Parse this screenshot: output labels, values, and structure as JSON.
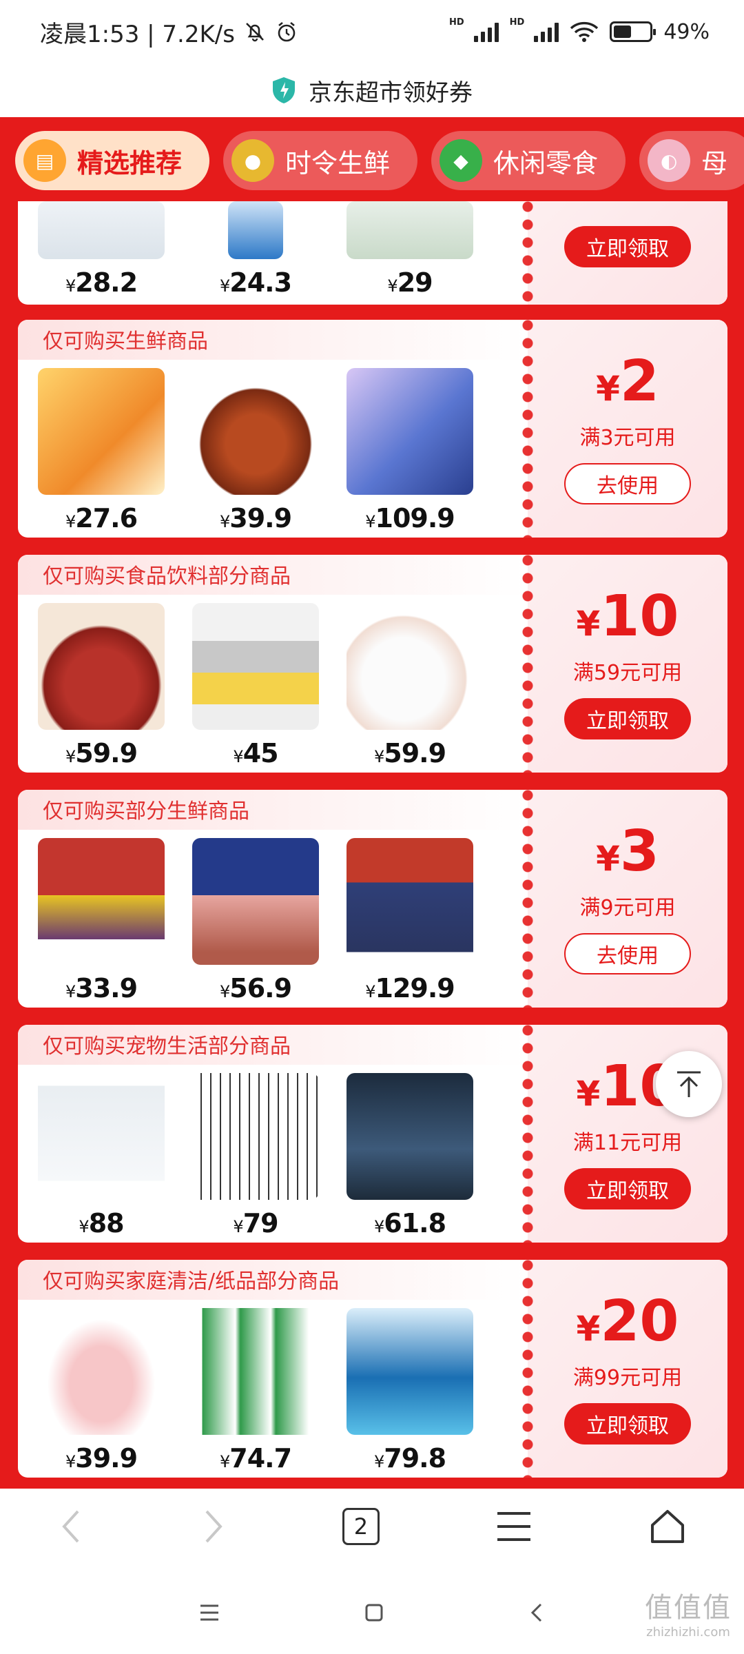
{
  "status_bar": {
    "time_net": "凌晨1:53 | 7.2K/s",
    "battery": "49%"
  },
  "title_bar": {
    "title": "京东超市领好券"
  },
  "tabs": [
    {
      "label": "精选推荐",
      "icon": "coupon-icon",
      "active": true
    },
    {
      "label": "时令生鲜",
      "icon": "durian-icon"
    },
    {
      "label": "休闲零食",
      "icon": "snack-icon"
    },
    {
      "label": "母",
      "icon": "bottle-icon"
    }
  ],
  "cards": [
    {
      "header": "",
      "products": [
        {
          "price": "28.2"
        },
        {
          "price": "24.3"
        },
        {
          "price": "29"
        }
      ],
      "amount": "",
      "condition": "",
      "button": "立即领取",
      "button_style": "filled"
    },
    {
      "header": "仅可购买生鲜商品",
      "products": [
        {
          "price": "27.6"
        },
        {
          "price": "39.9"
        },
        {
          "price": "109.9"
        }
      ],
      "amount": "2",
      "condition": "满3元可用",
      "button": "去使用",
      "button_style": "outline"
    },
    {
      "header": "仅可购买食品饮料部分商品",
      "products": [
        {
          "price": "59.9"
        },
        {
          "price": "45"
        },
        {
          "price": "59.9"
        }
      ],
      "amount": "10",
      "condition": "满59元可用",
      "button": "立即领取",
      "button_style": "filled"
    },
    {
      "header": "仅可购买部分生鲜商品",
      "products": [
        {
          "price": "33.9"
        },
        {
          "price": "56.9"
        },
        {
          "price": "129.9"
        }
      ],
      "amount": "3",
      "condition": "满9元可用",
      "button": "去使用",
      "button_style": "outline"
    },
    {
      "header": "仅可购买宠物生活部分商品",
      "products": [
        {
          "price": "88"
        },
        {
          "price": "79"
        },
        {
          "price": "61.8"
        }
      ],
      "amount": "10",
      "condition": "满11元可用",
      "button": "立即领取",
      "button_style": "filled"
    },
    {
      "header": "仅可购买家庭清洁/纸品部分商品",
      "products": [
        {
          "price": "39.9"
        },
        {
          "price": "74.7"
        },
        {
          "price": "79.8"
        }
      ],
      "amount": "20",
      "condition": "满99元可用",
      "button": "立即领取",
      "button_style": "filled"
    }
  ],
  "currency": "¥",
  "browser_nav": {
    "tab_count": "2"
  },
  "watermark": {
    "line1": "值值值",
    "line2": "zhizhizhi.com"
  },
  "colors": {
    "brand_red": "#e51b1b",
    "coupon_bg": "#fdeff0"
  }
}
